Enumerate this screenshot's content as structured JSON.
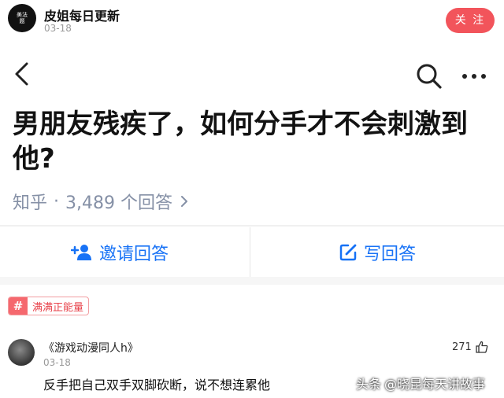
{
  "header": {
    "avatar_text": "美法题",
    "author_name": "皮姐每日更新",
    "date": "03-18",
    "follow_label": "关 注"
  },
  "question": {
    "title": "男朋友残疾了，如何分手才不会刺激到他?",
    "meta_source": "知乎",
    "meta_sep": "·",
    "meta_count": "3,489 个回答"
  },
  "actions": {
    "invite_label": "邀请回答",
    "write_label": "写回答"
  },
  "tag": {
    "hash": "#",
    "label": "满满正能量"
  },
  "comment": {
    "user": "《游戏动漫同人h》",
    "date": "03-18",
    "likes": "271",
    "text": "反手把自己双手双脚砍断，说不想连累他"
  },
  "watermark": {
    "platform": "头条",
    "handle": "@晓昆每天讲故事"
  },
  "colors": {
    "follow_bg": "#f2545b",
    "accent_blue": "#1772f6",
    "meta_gray": "#8590a6",
    "tag_red": "#f5686e"
  },
  "icons": [
    "back-icon",
    "search-icon",
    "more-icon",
    "chevron-right-icon",
    "add-person-icon",
    "edit-icon",
    "thumbs-up-icon"
  ]
}
